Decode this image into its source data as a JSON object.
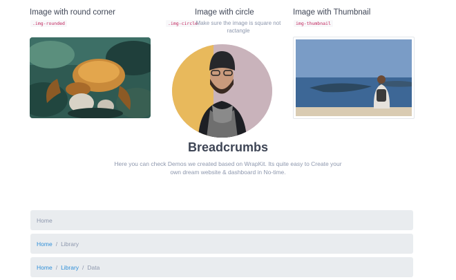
{
  "images": {
    "rounded": {
      "title": "Image with round corner",
      "code": ".img-rounded"
    },
    "circle": {
      "title": "Image with circle",
      "code": ".img-circle",
      "note": "Make sure the image is square not ractangle"
    },
    "thumbnail": {
      "title": "Image with Thumbnail",
      "code": "img-thumbnail"
    }
  },
  "breadcrumbs_section": {
    "title": "Breadcrumbs",
    "subtitle": "Here you can check Demos we created based on WrapKit. Its quite easy to Create your own dream website & dashboard in No-time."
  },
  "breadcrumbs": [
    {
      "items": [
        "Home"
      ]
    },
    {
      "items": [
        "Home",
        "Library"
      ]
    },
    {
      "items": [
        "Home",
        "Library",
        "Data"
      ]
    }
  ],
  "colors": {
    "link": "#2f8fd8",
    "muted": "#8d97ad",
    "breadcrumb_bg": "#e9ecef",
    "heading": "#3e4555",
    "code": "#c2255c"
  },
  "separator": "/"
}
